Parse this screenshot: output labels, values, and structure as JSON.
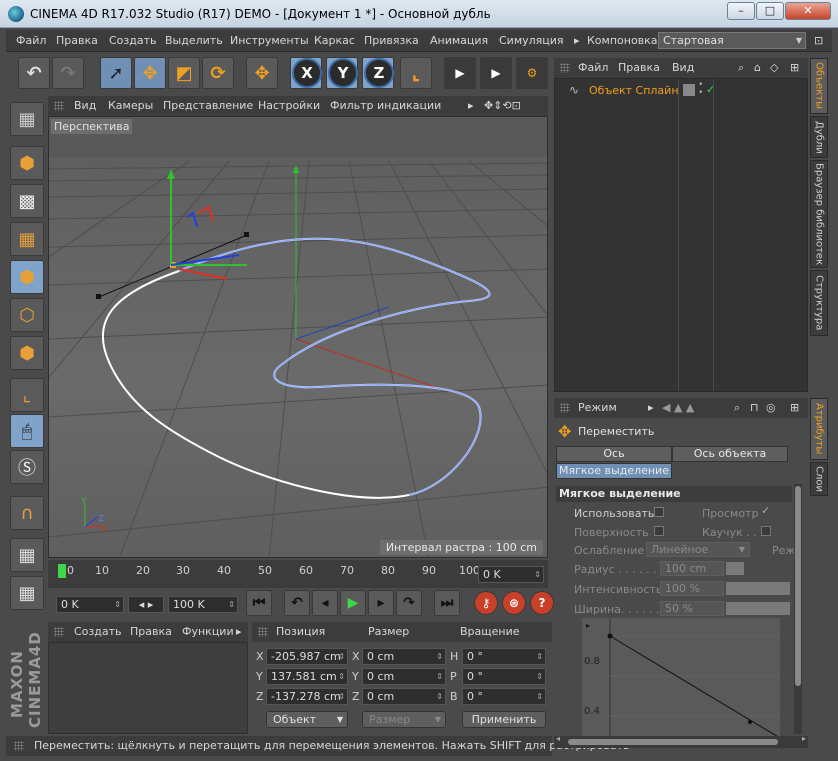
{
  "window": {
    "title": "CINEMA 4D R17.032 Studio (R17) DEMO - [Документ 1 *] - Основной дубль",
    "minimize_label": "–",
    "maximize_label": "□",
    "close_label": "✕"
  },
  "menubar": {
    "items": [
      "Файл",
      "Правка",
      "Создать",
      "Выделить",
      "Инструменты",
      "Каркас",
      "Привязка",
      "Анимация",
      "Симуляция",
      "Компоновка"
    ],
    "layout_value": "Стартовая"
  },
  "toolbar": {
    "axis_x": "X",
    "axis_y": "Y",
    "axis_z": "Z"
  },
  "viewport": {
    "menu": [
      "Вид",
      "Камеры",
      "Представление",
      "Настройки",
      "Фильтр индикации"
    ],
    "label": "Перспектива",
    "interval": "Интервал растра : 100 cm"
  },
  "timeline": {
    "ticks": [
      "0",
      "10",
      "20",
      "30",
      "40",
      "50",
      "60",
      "70",
      "80",
      "90",
      "100"
    ],
    "current_frame": "0 K"
  },
  "transport": {
    "start": "0 K",
    "end": "100 K"
  },
  "materials": {
    "menu": [
      "Создать",
      "Правка",
      "Функции"
    ]
  },
  "coords": {
    "headers": [
      "Позиция",
      "Размер",
      "Вращение"
    ],
    "rows": [
      {
        "axis": "X",
        "pos": "-205.987 cm",
        "size_axis": "X",
        "size": "0 cm",
        "rot_axis": "H",
        "rot": "0 °"
      },
      {
        "axis": "Y",
        "pos": "137.581 cm",
        "size_axis": "Y",
        "size": "0 cm",
        "rot_axis": "P",
        "rot": "0 °"
      },
      {
        "axis": "Z",
        "pos": "-137.278 cm",
        "size_axis": "Z",
        "size": "0 cm",
        "rot_axis": "B",
        "rot": "0 °"
      }
    ],
    "mode": "Объект",
    "size_mode": "Размер",
    "apply": "Применить"
  },
  "status": "Переместить: щёлкнуть и перетащить для перемещения элементов. Нажать SHIFT для растрировать",
  "object_manager": {
    "menu": [
      "Файл",
      "Правка",
      "Вид"
    ],
    "objects": [
      {
        "name": "Объект Сплайн"
      }
    ]
  },
  "side_tabs_top": [
    "Объекты",
    "Дубли",
    "Браузер библиотек",
    "Структура"
  ],
  "side_tabs_bottom": [
    "Атрибуты",
    "Слои"
  ],
  "attributes": {
    "mode_label": "Режим",
    "tool_name": "Переместить",
    "tabs": [
      "Ось моделирования",
      "Ось объекта",
      "Мягкое выделение"
    ],
    "section": "Мягкое выделение",
    "use_label": "Использовать",
    "preview_label": "Просмотр",
    "surface_label": "Поверхность",
    "rubber_label": "Каучук . . .",
    "falloff_label": "Ослабление",
    "falloff_value": "Линейное",
    "mode_short": "Реж",
    "radius_label": "Радиус . . . . . . .",
    "radius_value": "100 cm",
    "strength_label": "Интенсивность",
    "strength_value": "100 %",
    "width_label": "Ширина. . . . . .",
    "width_value": "50 %",
    "graph_tick_1": "0.8",
    "graph_tick_2": "0.4"
  },
  "logo": "MAXON CINEMA4D",
  "colors": {
    "accent": "#f0a020",
    "selection": "#6f8fb5",
    "spline_white": "#ffffff",
    "spline_blue": "#8aa8ff",
    "axis_red": "#e03020",
    "axis_green": "#30c030",
    "axis_blue": "#2040e0"
  }
}
